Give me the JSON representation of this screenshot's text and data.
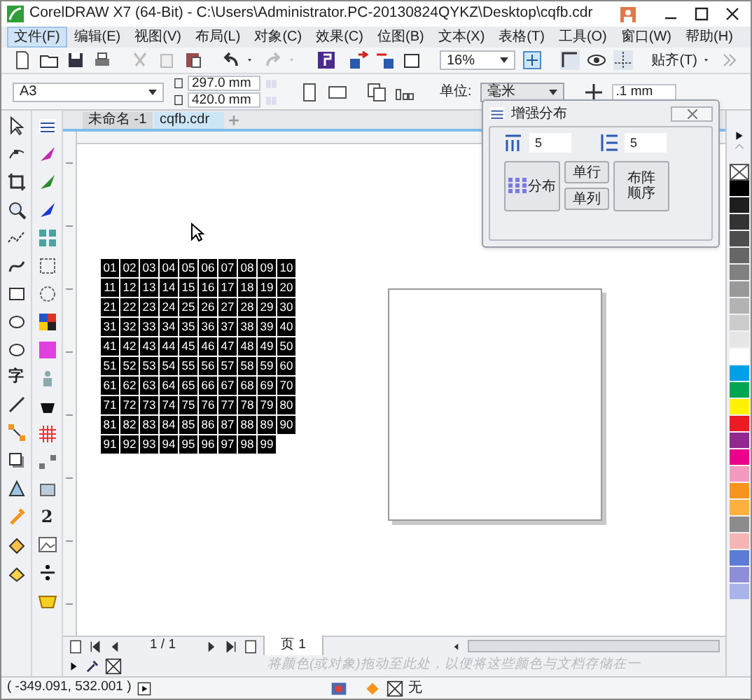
{
  "window": {
    "title": "CorelDRAW X7 (64-Bit) - C:\\Users\\Administrator.PC-20130824QYKZ\\Desktop\\cqfb.cdr"
  },
  "menu": [
    {
      "label": "文件(F)",
      "selected": true
    },
    {
      "label": "编辑(E)",
      "selected": false
    },
    {
      "label": "视图(V)",
      "selected": false
    },
    {
      "label": "布局(L)",
      "selected": false
    },
    {
      "label": "对象(C)",
      "selected": false
    },
    {
      "label": "效果(C)",
      "selected": false
    },
    {
      "label": "位图(B)",
      "selected": false
    },
    {
      "label": "文本(X)",
      "selected": false
    },
    {
      "label": "表格(T)",
      "selected": false
    },
    {
      "label": "工具(O)",
      "selected": false
    },
    {
      "label": "窗口(W)",
      "selected": false
    },
    {
      "label": "帮助(H)",
      "selected": false
    }
  ],
  "toolbar": {
    "zoom": "16%",
    "snap": "贴齐(T)"
  },
  "property_bar": {
    "page_size": "A3",
    "width": "297.0 mm",
    "height": "420.0 mm",
    "units_label": "单位:",
    "units": "毫米",
    "nudge": ".1 mm"
  },
  "toolbox": {
    "text_tool": "字",
    "column_2_glyph": "2"
  },
  "tabs": [
    {
      "label": "未命名 -1",
      "selected": false
    },
    {
      "label": "cqfb.cdr",
      "selected": true
    }
  ],
  "number_grid": [
    [
      "01",
      "02",
      "03",
      "04",
      "05",
      "06",
      "07",
      "08",
      "09",
      "10"
    ],
    [
      "11",
      "12",
      "13",
      "14",
      "15",
      "16",
      "17",
      "18",
      "19",
      "20"
    ],
    [
      "21",
      "22",
      "23",
      "24",
      "25",
      "26",
      "27",
      "28",
      "29",
      "30"
    ],
    [
      "31",
      "32",
      "33",
      "34",
      "35",
      "36",
      "37",
      "38",
      "39",
      "40"
    ],
    [
      "41",
      "42",
      "43",
      "44",
      "45",
      "46",
      "47",
      "48",
      "49",
      "50"
    ],
    [
      "51",
      "52",
      "53",
      "54",
      "55",
      "56",
      "57",
      "58",
      "59",
      "60"
    ],
    [
      "61",
      "62",
      "63",
      "64",
      "65",
      "66",
      "67",
      "68",
      "69",
      "70"
    ],
    [
      "71",
      "72",
      "73",
      "74",
      "75",
      "76",
      "77",
      "78",
      "79",
      "80"
    ],
    [
      "81",
      "82",
      "83",
      "84",
      "85",
      "86",
      "87",
      "88",
      "89",
      "90"
    ],
    [
      "91",
      "92",
      "93",
      "94",
      "95",
      "96",
      "97",
      "98",
      "99"
    ]
  ],
  "docker": {
    "title": "增强分布",
    "columns": "5",
    "rows": "5",
    "distribute": "分布",
    "single_row": "单行",
    "single_column": "单列",
    "array_order": "布阵顺序"
  },
  "palette": [
    {
      "color": "#000000"
    },
    {
      "color": "#1e1e1e"
    },
    {
      "color": "#333333"
    },
    {
      "color": "#4d4d4d"
    },
    {
      "color": "#666666"
    },
    {
      "color": "#808080"
    },
    {
      "color": "#999999"
    },
    {
      "color": "#b3b3b3"
    },
    {
      "color": "#cccccc"
    },
    {
      "color": "#e6e6e6"
    },
    {
      "color": "#ffffff"
    },
    {
      "color": "#00a0e9"
    },
    {
      "color": "#00a651"
    },
    {
      "color": "#fff200"
    },
    {
      "color": "#ed1c24"
    },
    {
      "color": "#92278f"
    },
    {
      "color": "#ec008c"
    },
    {
      "color": "#f49ac1"
    },
    {
      "color": "#f7941d"
    },
    {
      "color": "#fbb040"
    },
    {
      "color": "#8c8c8c"
    },
    {
      "color": "#f5b5b5"
    },
    {
      "color": "#5b7bd5"
    },
    {
      "color": "#8e8ed8"
    },
    {
      "color": "#aab4e8"
    }
  ],
  "page_nav": {
    "position": "1 / 1",
    "page_tab": "页 1"
  },
  "color_strip": {
    "hint": "将颜色(或对象)拖动至此处，以便将这些颜色与文档存储在一"
  },
  "status_bar": {
    "coordinates": "( -349.091, 532.001 )",
    "fill": "无"
  }
}
